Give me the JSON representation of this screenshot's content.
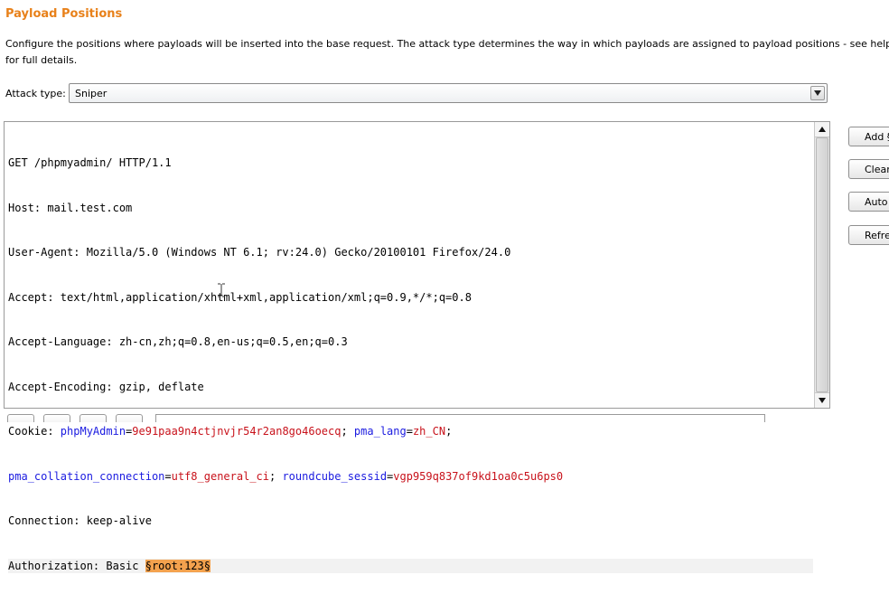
{
  "section": {
    "title": "Payload Positions",
    "description": "Configure the positions where payloads will be inserted into the base request. The attack type determines the way in which payloads are assigned to payload positions - see help for full details."
  },
  "attack_type": {
    "label": "Attack type:",
    "value": "Sniper"
  },
  "request": {
    "line1": "GET /phpmyadmin/ HTTP/1.1",
    "host": "Host: mail.test.com",
    "user_agent": "User-Agent: Mozilla/5.0 (Windows NT 6.1; rv:24.0) Gecko/20100101 Firefox/24.0",
    "accept": "Accept: text/html,application/xhtml+xml,application/xml;q=0.9,*/*;q=0.8",
    "accept_language": "Accept-Language: zh-cn,zh;q=0.8,en-us;q=0.5,en;q=0.3",
    "accept_encoding": "Accept-Encoding: gzip, deflate",
    "cookie_prefix": "Cookie: ",
    "cookie_k1": "phpMyAdmin",
    "cookie_v1": "9e91paa9n4ctjnvjr54r2an8go46oecq",
    "cookie_k2": "pma_lang",
    "cookie_v2": "zh_CN",
    "cookie_k3": "pma_collation_connection",
    "cookie_v3": "utf8_general_ci",
    "cookie_k4": "roundcube_sessid",
    "cookie_v4": "vgp959q837of9kd1oa0c5u6ps0",
    "connection": "Connection: keep-alive",
    "auth_prefix": "Authorization: Basic ",
    "auth_payload": "§root:123§"
  },
  "side_buttons": {
    "add": "Add §",
    "clear": "Clear §",
    "auto": "Auto §",
    "refresh": "Refresh"
  },
  "colors": {
    "title": "#e8811a",
    "cookie_name": "#1b1be0",
    "cookie_value": "#c8121b",
    "payload_highlight": "#f4a24e"
  }
}
